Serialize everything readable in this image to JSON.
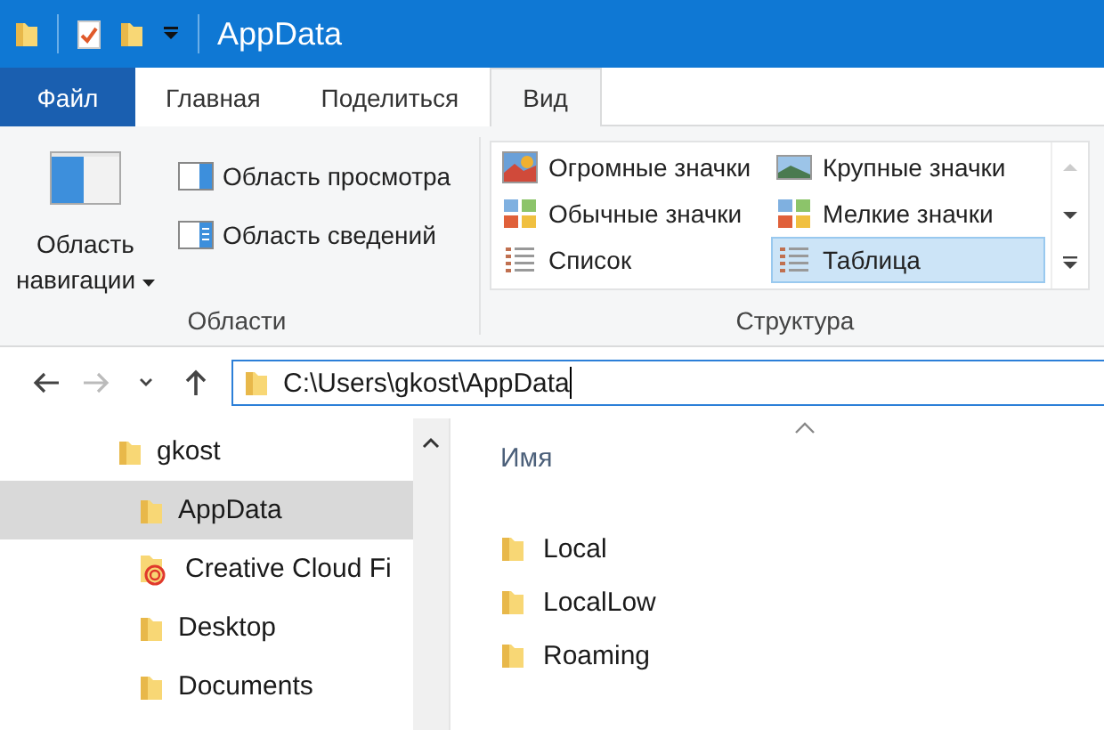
{
  "window": {
    "title": "AppData"
  },
  "tabs": [
    {
      "label": "Файл",
      "kind": "file",
      "selected": false
    },
    {
      "label": "Главная",
      "kind": "tab",
      "selected": false
    },
    {
      "label": "Поделиться",
      "kind": "tab",
      "selected": false
    },
    {
      "label": "Вид",
      "kind": "tab",
      "selected": true
    }
  ],
  "ribbon": {
    "panes_group": {
      "name": "Области",
      "navigation_pane": {
        "label_line1": "Область",
        "label_line2": "навигации"
      },
      "buttons": [
        {
          "label": "Область просмотра",
          "kind": "preview"
        },
        {
          "label": "Область сведений",
          "kind": "details"
        }
      ]
    },
    "layout_group": {
      "name": "Структура",
      "items": [
        {
          "label": "Огромные значки",
          "selected": false
        },
        {
          "label": "Крупные значки",
          "selected": false
        },
        {
          "label": "Обычные значки",
          "selected": false
        },
        {
          "label": "Мелкие значки",
          "selected": false
        },
        {
          "label": "Список",
          "selected": false
        },
        {
          "label": "Таблица",
          "selected": true
        }
      ]
    }
  },
  "nav_buttons": [
    {
      "kind": "back",
      "disabled": false
    },
    {
      "kind": "forward",
      "disabled": true
    },
    {
      "kind": "recent",
      "disabled": false
    },
    {
      "kind": "up",
      "disabled": false
    }
  ],
  "address": {
    "value": "C:\\Users\\gkost\\AppData"
  },
  "sidebar": {
    "items": [
      {
        "label": "gkost",
        "selected": false,
        "kind": "folder",
        "children": [
          {
            "label": "AppData",
            "selected": true,
            "kind": "folder"
          },
          {
            "label": "Creative Cloud Fi",
            "selected": false,
            "kind": "cloud"
          },
          {
            "label": "Desktop",
            "selected": false,
            "kind": "folder"
          },
          {
            "label": "Documents",
            "selected": false,
            "kind": "folder"
          }
        ]
      }
    ]
  },
  "file_list": {
    "columns": [
      "Имя"
    ],
    "rows": [
      {
        "name": "Local"
      },
      {
        "name": "LocalLow"
      },
      {
        "name": "Roaming"
      }
    ]
  }
}
